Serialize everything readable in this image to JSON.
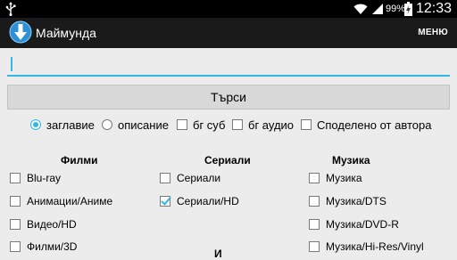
{
  "status_bar": {
    "battery": "99%",
    "time": "12:33"
  },
  "action_bar": {
    "title": "Маймунда",
    "menu_label": "МЕНЮ"
  },
  "search": {
    "value": "",
    "placeholder": "",
    "button_label": "Търси"
  },
  "options": {
    "radio_title": "заглавие",
    "radio_title_selected": true,
    "radio_description": "описание",
    "radio_description_selected": false,
    "bg_sub": "бг суб",
    "bg_sub_checked": false,
    "bg_audio": "бг аудио",
    "bg_audio_checked": false,
    "shared_by_author": "Споделено от автора",
    "shared_by_author_checked": false
  },
  "categories": {
    "films": {
      "header": "Филми",
      "items": [
        {
          "label": "Blu-ray",
          "checked": false
        },
        {
          "label": "Анимации/Аниме",
          "checked": false
        },
        {
          "label": "Видео/HD",
          "checked": false
        },
        {
          "label": "Филми/3D",
          "checked": false
        }
      ]
    },
    "series": {
      "header": "Сериали",
      "items": [
        {
          "label": "Сериали",
          "checked": false
        },
        {
          "label": "Сериали/HD",
          "checked": true
        }
      ]
    },
    "music": {
      "header": "Музика",
      "items": [
        {
          "label": "Музика",
          "checked": false
        },
        {
          "label": "Музика/DTS",
          "checked": false
        },
        {
          "label": "Музика/DVD-R",
          "checked": false
        },
        {
          "label": "Музика/Hi-Res/Vinyl",
          "checked": false
        }
      ]
    },
    "partial_next_header": "И"
  },
  "colors": {
    "accent": "#33b5e5",
    "action_bar": "#1a1a1a",
    "background": "#ececec"
  }
}
